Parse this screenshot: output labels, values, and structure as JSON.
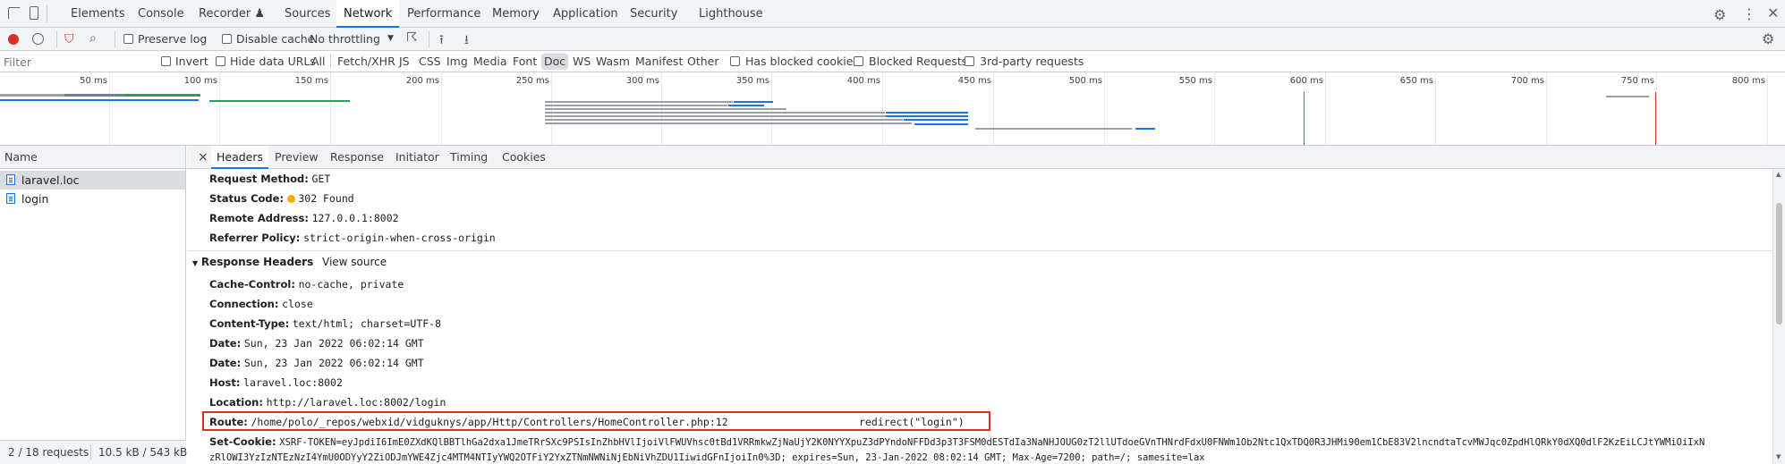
{
  "tabs": [
    {
      "label": "Elements"
    },
    {
      "label": "Console"
    },
    {
      "label": "Recorder ♟"
    },
    {
      "label": "Sources"
    },
    {
      "label": "Network"
    },
    {
      "label": "Performance"
    },
    {
      "label": "Memory"
    },
    {
      "label": "Application"
    },
    {
      "label": "Security"
    },
    {
      "label": "Lighthouse"
    }
  ],
  "toolbar": {
    "preserve_log": "Preserve log",
    "disable_cache": "Disable cache",
    "throttling": "No throttling"
  },
  "filterbar": {
    "placeholder": "Filter",
    "invert": "Invert",
    "hide_data_urls": "Hide data URLs",
    "types": [
      "All",
      "Fetch/XHR",
      "JS",
      "CSS",
      "Img",
      "Media",
      "Font",
      "Doc",
      "WS",
      "Wasm",
      "Manifest",
      "Other"
    ],
    "selected_type": "Doc",
    "has_blocked_cookies": "Has blocked cookies",
    "blocked_requests": "Blocked Requests",
    "third_party": "3rd-party requests"
  },
  "overview": {
    "ticks": [
      "50 ms",
      "100 ms",
      "150 ms",
      "200 ms",
      "250 ms",
      "300 ms",
      "350 ms",
      "400 ms",
      "450 ms",
      "500 ms",
      "550 ms",
      "600 ms",
      "650 ms",
      "700 ms",
      "750 ms",
      "800 ms"
    ]
  },
  "requests": {
    "header": "Name",
    "items": [
      {
        "name": "laravel.loc"
      },
      {
        "name": "login"
      }
    ],
    "footer_count": "2 / 18 requests",
    "footer_size": "10.5 kB / 543 kB t"
  },
  "detail": {
    "close": "×",
    "tabs": [
      {
        "label": "Headers"
      },
      {
        "label": "Preview"
      },
      {
        "label": "Response"
      },
      {
        "label": "Initiator"
      },
      {
        "label": "Timing"
      },
      {
        "label": "Cookies"
      }
    ],
    "general": [
      {
        "k": "Request Method:",
        "v": "GET"
      },
      {
        "k": "Status Code:",
        "v": "302 Found"
      },
      {
        "k": "Remote Address:",
        "v": "127.0.0.1:8002"
      },
      {
        "k": "Referrer Policy:",
        "v": "strict-origin-when-cross-origin"
      }
    ],
    "response_headers_title": "Response Headers",
    "view_source": "View source",
    "response_headers": [
      {
        "k": "Cache-Control:",
        "v": "no-cache, private"
      },
      {
        "k": "Connection:",
        "v": "close"
      },
      {
        "k": "Content-Type:",
        "v": "text/html; charset=UTF-8"
      },
      {
        "k": "Date:",
        "v": "Sun, 23 Jan 2022 06:02:14 GMT"
      },
      {
        "k": "Date:",
        "v": "Sun, 23 Jan 2022 06:02:14 GMT"
      },
      {
        "k": "Host:",
        "v": "laravel.loc:8002"
      },
      {
        "k": "Location:",
        "v": "http://laravel.loc:8002/login"
      }
    ],
    "route_key": "Route:",
    "route_path": "/home/polo/_repos/webxid/vidguknys/app/Http/Controllers/HomeController.php:12",
    "route_call": "redirect(\"login\")",
    "setcookie_key": "Set-Cookie:",
    "setcookie_line1": "XSRF-TOKEN=eyJpdiI6ImE0ZXdKQlBBTlhGa2dxa1JmeTRrSXc9PSIsInZhbHVlIjoiVlFWUVhsc0tBd1VRRmkwZjNaUjY2K0NYYXpuZ3dPYndoNFFDd3p3T3FSM0dESTdIa3NaNHJOUG0zT2llUTdoeGVnTHNrdFdxU0FNWm1Ob2Ntc1QxTDQ0R3JHMi90em1CbE83V2lncndtaTcvMWJqc0ZpdHlQRkY0dXQ0dlF2KzEiLCJtYWMiOiIxN",
    "setcookie_line2": "zRlOWI3YzIzNTEzNzI4YmU0ODYyY2ZiODJmYWE4Zjc4MTM4NTIyYWQ2OTFiY2YxZTNmNWNiNjEbNiVhZDU1IiwidGFnIjoiIn0%3D; expires=Sun, 23-Jan-2022 08:02:14 GMT; Max-Age=7200; path=/; samesite=lax"
  },
  "colors": {
    "accent": "#1a73e8",
    "record": "#d93025",
    "highlight": "#d93025"
  }
}
